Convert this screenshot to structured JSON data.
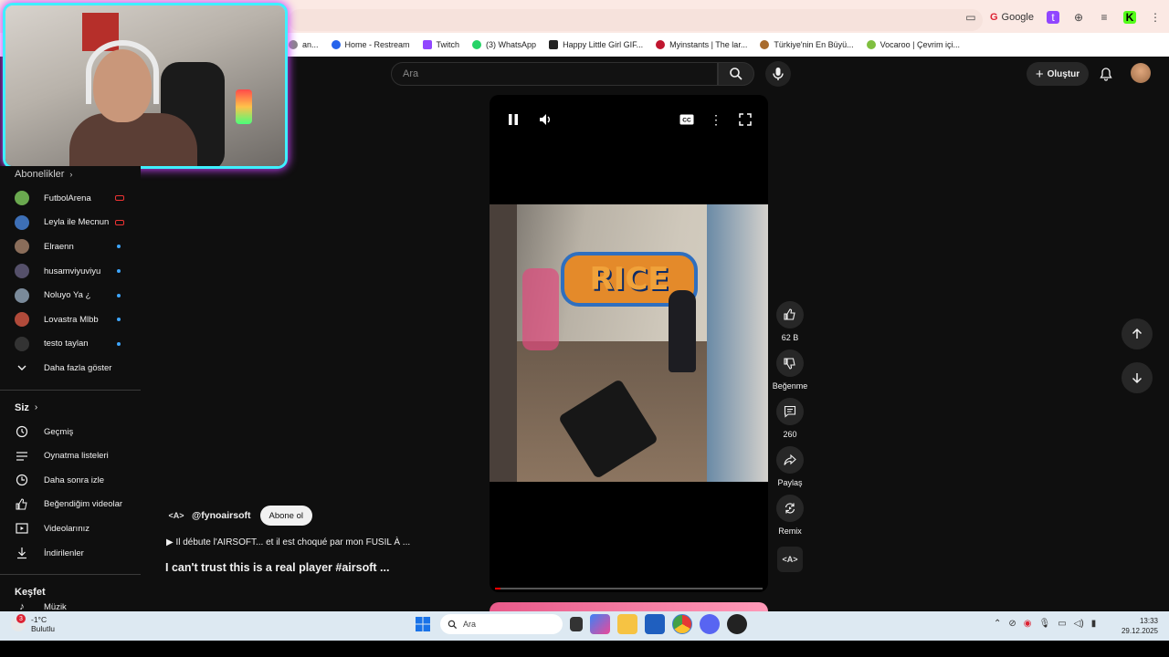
{
  "browser": {
    "bookmarks": [
      {
        "label": "an...",
        "color": "#888888"
      },
      {
        "label": "Home - Restream",
        "color": "#2563eb"
      },
      {
        "label": "Twitch",
        "color": "#9146ff"
      },
      {
        "label": "(3) WhatsApp",
        "color": "#25d366"
      },
      {
        "label": "Happy Little Girl GIF...",
        "color": "#222222"
      },
      {
        "label": "Myinstants | The lar...",
        "color": "#c0162f"
      },
      {
        "label": "Türkiye'nin En Büyü...",
        "color": "#a86b2d"
      },
      {
        "label": "Vocaroo | Çevrim içi...",
        "color": "#7fbf3f"
      }
    ],
    "top_right_label": "Google"
  },
  "header": {
    "search_placeholder": "Ara",
    "create_label": "Oluştur"
  },
  "sidebar": {
    "subscriptions_title": "Abonelikler",
    "subscriptions": [
      {
        "name": "FutbolArena",
        "status": "live",
        "color": "#6aa84f"
      },
      {
        "name": "Leyla ile Mecnun",
        "status": "live",
        "color": "#3d6fb6"
      },
      {
        "name": "Elraenn",
        "status": "new",
        "color": "#8a6d5a"
      },
      {
        "name": "husamviyuviyu",
        "status": "new",
        "color": "#55506a"
      },
      {
        "name": "Noluyo Ya ¿",
        "status": "new",
        "color": "#7a8a9a"
      },
      {
        "name": "Lovastra Mlbb",
        "status": "new",
        "color": "#b04a3a"
      },
      {
        "name": "testo taylan",
        "status": "new",
        "color": "#333333"
      }
    ],
    "show_more": "Daha fazla göster",
    "you_title": "Siz",
    "you_items": [
      {
        "label": "Geçmiş",
        "icon": "history-icon"
      },
      {
        "label": "Oynatma listeleri",
        "icon": "playlist-icon"
      },
      {
        "label": "Daha sonra izle",
        "icon": "clock-icon"
      },
      {
        "label": "Beğendiğim videolar",
        "icon": "thumb-up-icon"
      },
      {
        "label": "Videolarınız",
        "icon": "video-icon"
      },
      {
        "label": "İndirilenler",
        "icon": "download-icon"
      }
    ],
    "explore_title": "Keşfet",
    "explore_partial": "Müzik"
  },
  "short": {
    "channel_logo": "<A>",
    "channel": "@fynoairsoft",
    "subscribe_label": "Abone ol",
    "playlist_text": "▶ Il débute l'AIRSOFT... et il est choqué par mon FUSIL À ...",
    "title": "I can't trust this is a real player #airsoft ...",
    "graffiti": "RICE",
    "progress": 0.02,
    "actions": {
      "likes": "62 B",
      "dislike_label": "Beğenme",
      "comments": "260",
      "share_label": "Paylaş",
      "remix_label": "Remix"
    }
  },
  "taskbar": {
    "temperature": "-1°C",
    "weather": "Bulutlu",
    "weather_badge": "3",
    "search_placeholder": "Ara",
    "time": "13:33",
    "date": "29.12.2025"
  }
}
